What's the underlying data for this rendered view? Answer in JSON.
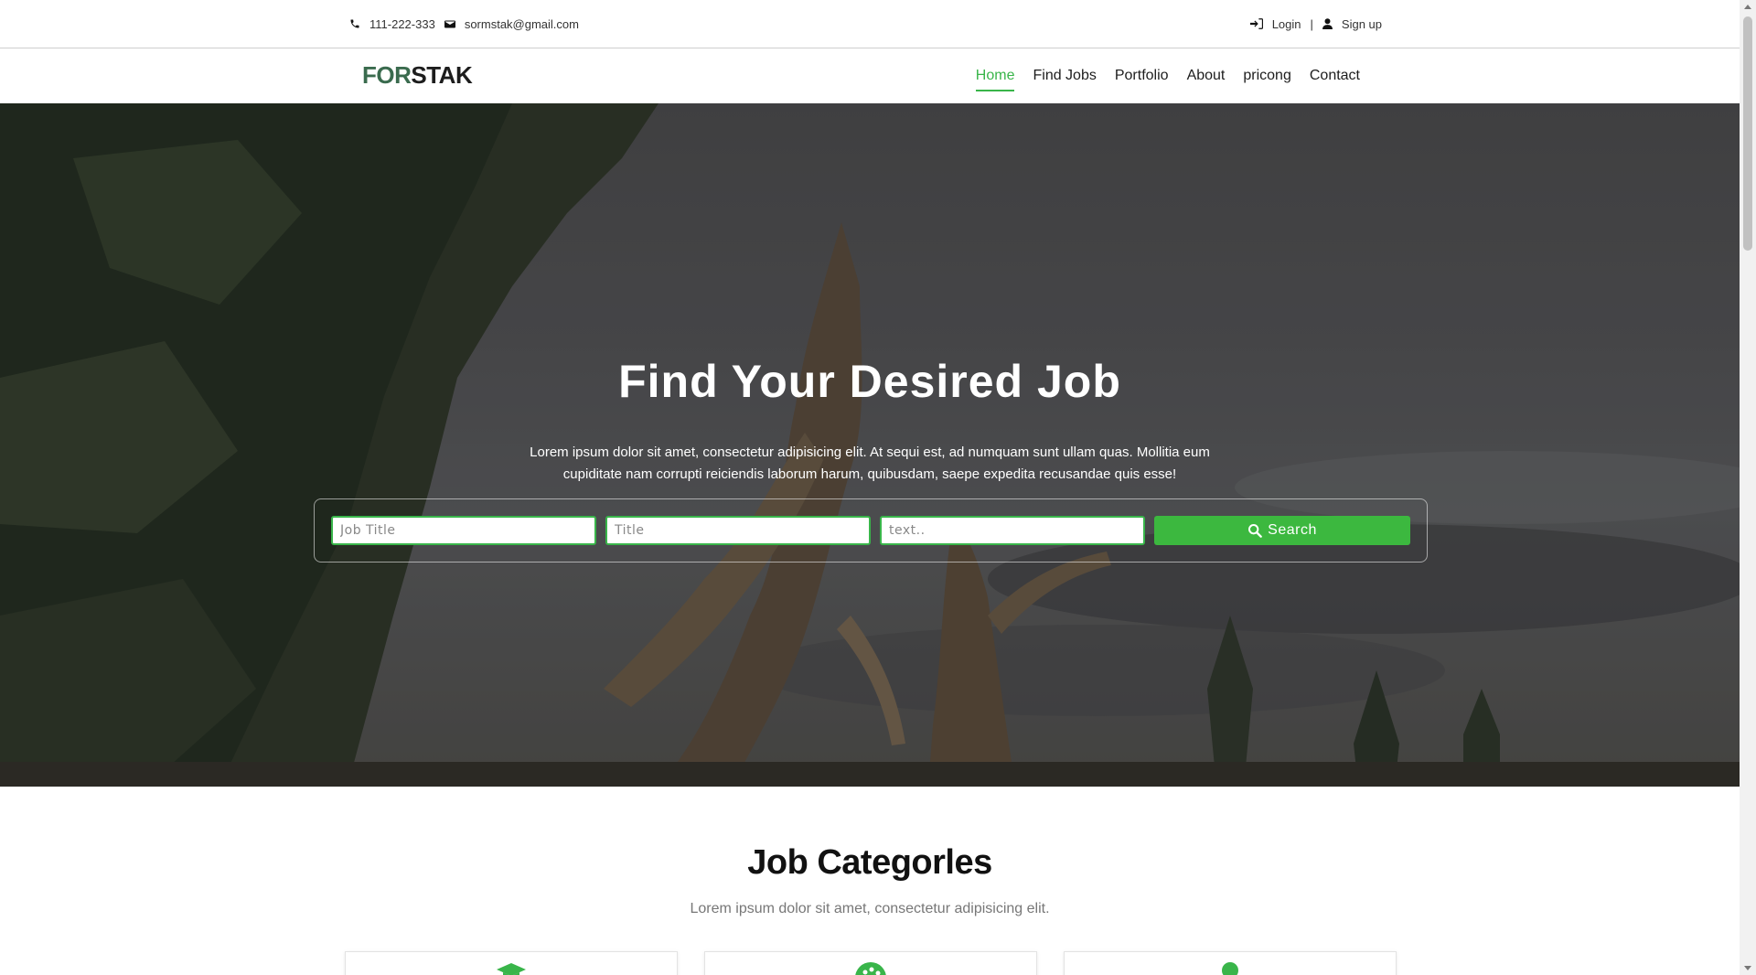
{
  "topbar": {
    "phone": "111-222-333",
    "email": "sormstak@gmail.com",
    "login_label": "Login",
    "separator": "|",
    "signup_label": "Sign up"
  },
  "brand": {
    "part1": "FOR",
    "part2": "STAK",
    "accent_color": "#3a6b4e"
  },
  "nav": {
    "items": [
      {
        "label": "Home",
        "active": true
      },
      {
        "label": "Find Jobs",
        "active": false
      },
      {
        "label": "Portfolio",
        "active": false
      },
      {
        "label": "About",
        "active": false
      },
      {
        "label": "pricong",
        "active": false
      },
      {
        "label": "Contact",
        "active": false
      }
    ],
    "active_color": "#39b54a"
  },
  "hero": {
    "title": "Find Your Desired Job",
    "lead": "Lorem ipsum dolor sit amet, consectetur adipisicing elit. At sequi est, ad numquam sunt ullam quas. Mollitia eum cupiditate nam corrupti reiciendis laborum harum, quibusdam, saepe expedita recusandae quis esse!",
    "search": {
      "field1_placeholder": "Job Title",
      "field2_placeholder": "Title",
      "field3_placeholder": "text..",
      "button_label": "Search",
      "button_color": "#3cb83f"
    }
  },
  "categories": {
    "title": "Job Categorles",
    "subtitle": "Lorem ipsum dolor sit amet, consectetur adipisicing elit.",
    "cards": [
      {
        "icon": "graduation-cap-icon"
      },
      {
        "icon": "palette-icon"
      },
      {
        "icon": "user-icon"
      }
    ]
  },
  "icons": {
    "phone": "phone-icon",
    "email": "envelope-icon",
    "login": "sign-in-icon",
    "signup": "user-icon",
    "search": "search-icon"
  }
}
